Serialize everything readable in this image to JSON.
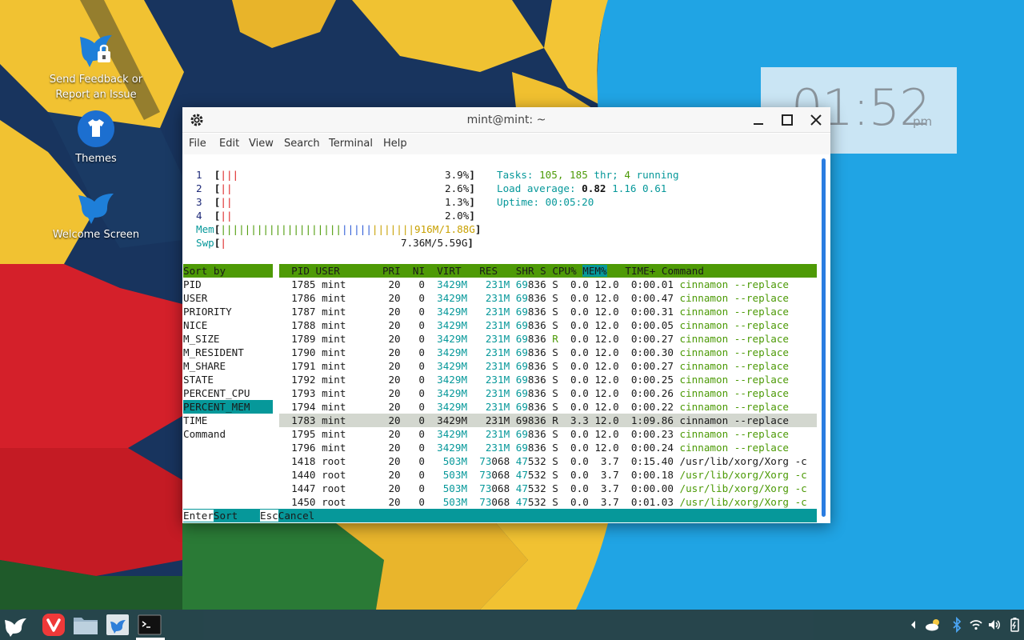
{
  "desktop": {
    "icons": [
      {
        "label": "Send Feedback or Report an Issue",
        "line1": "Send Feedback or",
        "line2": "Report an Issue"
      },
      {
        "label": "Themes"
      },
      {
        "label": "Welcome Screen"
      }
    ]
  },
  "clock": {
    "time": "01:52",
    "ampm": "pm"
  },
  "window": {
    "title": "mint@mint: ~",
    "menu": [
      "File",
      "Edit",
      "View",
      "Search",
      "Terminal",
      "Help"
    ]
  },
  "htop": {
    "cpus": [
      {
        "id": "1",
        "bars": "|||",
        "pct": "3.9%"
      },
      {
        "id": "2",
        "bars": "||",
        "pct": "2.6%"
      },
      {
        "id": "3",
        "bars": "||",
        "pct": "1.3%"
      },
      {
        "id": "4",
        "bars": "||",
        "pct": "2.0%"
      }
    ],
    "mem": {
      "label": "Mem",
      "value": "916M/1.88G"
    },
    "swp": {
      "label": "Swp",
      "value": "7.36M/5.59G"
    },
    "tasks": {
      "label": "Tasks:",
      "count": "105,",
      "thr": "185",
      "thr_label": "thr;",
      "running": "4",
      "running_label": "running"
    },
    "load": {
      "label": "Load average:",
      "v1": "0.82",
      "v2": "1.16",
      "v3": "0.61"
    },
    "uptime": {
      "label": "Uptime:",
      "value": "00:05:20"
    },
    "sort_title": "Sort by",
    "sort_options": [
      "PID",
      "USER",
      "PRIORITY",
      "NICE",
      "M_SIZE",
      "M_RESIDENT",
      "M_SHARE",
      "STATE",
      "PERCENT_CPU",
      "PERCENT_MEM",
      "TIME",
      "Command"
    ],
    "sort_selected": "PERCENT_MEM",
    "columns": [
      "PID",
      "USER",
      "PRI",
      "NI",
      "VIRT",
      "RES",
      "SHR",
      "S",
      "CPU%",
      "MEM%",
      "TIME+",
      "Command"
    ],
    "processes": [
      {
        "pid": "1785",
        "user": "mint",
        "pri": "20",
        "ni": "0",
        "virt": "3429M",
        "res": "231M",
        "shr_a": "69",
        "shr_b": "836",
        "s": "S",
        "cpu": "0.0",
        "mem": "12.0",
        "time": "0:00.01",
        "cmd": "cinnamon --replace"
      },
      {
        "pid": "1786",
        "user": "mint",
        "pri": "20",
        "ni": "0",
        "virt": "3429M",
        "res": "231M",
        "shr_a": "69",
        "shr_b": "836",
        "s": "S",
        "cpu": "0.0",
        "mem": "12.0",
        "time": "0:00.47",
        "cmd": "cinnamon --replace"
      },
      {
        "pid": "1787",
        "user": "mint",
        "pri": "20",
        "ni": "0",
        "virt": "3429M",
        "res": "231M",
        "shr_a": "69",
        "shr_b": "836",
        "s": "S",
        "cpu": "0.0",
        "mem": "12.0",
        "time": "0:00.31",
        "cmd": "cinnamon --replace"
      },
      {
        "pid": "1788",
        "user": "mint",
        "pri": "20",
        "ni": "0",
        "virt": "3429M",
        "res": "231M",
        "shr_a": "69",
        "shr_b": "836",
        "s": "S",
        "cpu": "0.0",
        "mem": "12.0",
        "time": "0:00.05",
        "cmd": "cinnamon --replace"
      },
      {
        "pid": "1789",
        "user": "mint",
        "pri": "20",
        "ni": "0",
        "virt": "3429M",
        "res": "231M",
        "shr_a": "69",
        "shr_b": "836",
        "s": "R",
        "cpu": "0.0",
        "mem": "12.0",
        "time": "0:00.27",
        "cmd": "cinnamon --replace"
      },
      {
        "pid": "1790",
        "user": "mint",
        "pri": "20",
        "ni": "0",
        "virt": "3429M",
        "res": "231M",
        "shr_a": "69",
        "shr_b": "836",
        "s": "S",
        "cpu": "0.0",
        "mem": "12.0",
        "time": "0:00.30",
        "cmd": "cinnamon --replace"
      },
      {
        "pid": "1791",
        "user": "mint",
        "pri": "20",
        "ni": "0",
        "virt": "3429M",
        "res": "231M",
        "shr_a": "69",
        "shr_b": "836",
        "s": "S",
        "cpu": "0.0",
        "mem": "12.0",
        "time": "0:00.27",
        "cmd": "cinnamon --replace"
      },
      {
        "pid": "1792",
        "user": "mint",
        "pri": "20",
        "ni": "0",
        "virt": "3429M",
        "res": "231M",
        "shr_a": "69",
        "shr_b": "836",
        "s": "S",
        "cpu": "0.0",
        "mem": "12.0",
        "time": "0:00.25",
        "cmd": "cinnamon --replace"
      },
      {
        "pid": "1793",
        "user": "mint",
        "pri": "20",
        "ni": "0",
        "virt": "3429M",
        "res": "231M",
        "shr_a": "69",
        "shr_b": "836",
        "s": "S",
        "cpu": "0.0",
        "mem": "12.0",
        "time": "0:00.26",
        "cmd": "cinnamon --replace"
      },
      {
        "pid": "1794",
        "user": "mint",
        "pri": "20",
        "ni": "0",
        "virt": "3429M",
        "res": "231M",
        "shr_a": "69",
        "shr_b": "836",
        "s": "S",
        "cpu": "0.0",
        "mem": "12.0",
        "time": "0:00.22",
        "cmd": "cinnamon --replace"
      },
      {
        "pid": "1783",
        "user": "mint",
        "pri": "20",
        "ni": "0",
        "virt": "3429M",
        "res": "231M",
        "shr_a": "69",
        "shr_b": "836",
        "s": "R",
        "cpu": "3.3",
        "mem": "12.0",
        "time": "1:09.86",
        "cmd": "cinnamon --replace"
      },
      {
        "pid": "1795",
        "user": "mint",
        "pri": "20",
        "ni": "0",
        "virt": "3429M",
        "res": "231M",
        "shr_a": "69",
        "shr_b": "836",
        "s": "S",
        "cpu": "0.0",
        "mem": "12.0",
        "time": "0:00.23",
        "cmd": "cinnamon --replace"
      },
      {
        "pid": "1796",
        "user": "mint",
        "pri": "20",
        "ni": "0",
        "virt": "3429M",
        "res": "231M",
        "shr_a": "69",
        "shr_b": "836",
        "s": "S",
        "cpu": "0.0",
        "mem": "12.0",
        "time": "0:00.24",
        "cmd": "cinnamon --replace"
      },
      {
        "pid": "1418",
        "user": "root",
        "pri": "20",
        "ni": "0",
        "virt": "503M",
        "res_a": "73",
        "res_b": "068",
        "shr_a": "47",
        "shr_b": "532",
        "s": "S",
        "cpu": "0.0",
        "mem": "3.7",
        "time": "0:15.40",
        "cmd": "/usr/lib/xorg/Xorg -c"
      },
      {
        "pid": "1440",
        "user": "root",
        "pri": "20",
        "ni": "0",
        "virt": "503M",
        "res_a": "73",
        "res_b": "068",
        "shr_a": "47",
        "shr_b": "532",
        "s": "S",
        "cpu": "0.0",
        "mem": "3.7",
        "time": "0:00.18",
        "cmd": "/usr/lib/xorg/Xorg -c"
      },
      {
        "pid": "1447",
        "user": "root",
        "pri": "20",
        "ni": "0",
        "virt": "503M",
        "res_a": "73",
        "res_b": "068",
        "shr_a": "47",
        "shr_b": "532",
        "s": "S",
        "cpu": "0.0",
        "mem": "3.7",
        "time": "0:00.00",
        "cmd": "/usr/lib/xorg/Xorg -c"
      },
      {
        "pid": "1450",
        "user": "root",
        "pri": "20",
        "ni": "0",
        "virt": "503M",
        "res_a": "73",
        "res_b": "068",
        "shr_a": "47",
        "shr_b": "532",
        "s": "S",
        "cpu": "0.0",
        "mem": "3.7",
        "time": "0:01.03",
        "cmd": "/usr/lib/xorg/Xorg -c"
      }
    ],
    "highlighted_pid": "1783",
    "footer": [
      {
        "key": "Enter",
        "action": "Sort"
      },
      {
        "key": "Esc",
        "action": "Cancel"
      }
    ]
  },
  "taskbar": {
    "apps": [
      "menu-icon",
      "vivaldi-icon",
      "files-icon",
      "mintinstall-icon",
      "terminal-icon"
    ]
  },
  "colors": {
    "htop_green": "#4e9a06",
    "htop_cyan": "#06989a",
    "desktop_blue": "#1fa3e2"
  }
}
